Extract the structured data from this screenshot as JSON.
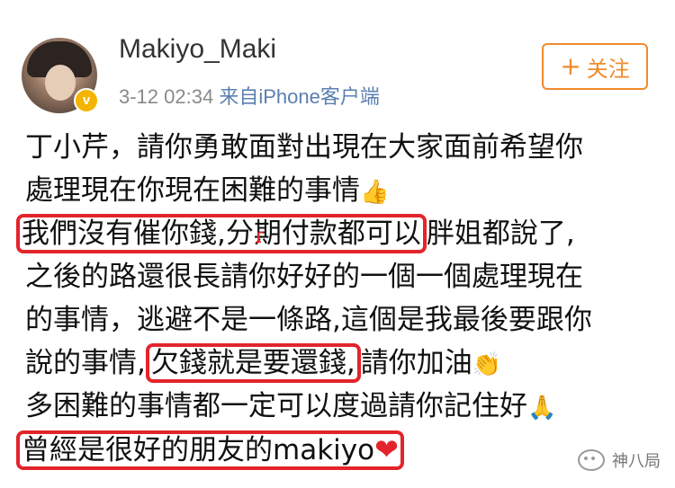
{
  "post": {
    "username": "Makiyo_Maki",
    "timestamp": "3-12 02:34",
    "source": "来自iPhone客户端",
    "follow_label": "关注",
    "verified_mark": "v"
  },
  "content": {
    "line1": "丁小芹，請你勇敢面對出現在大家面前希望你",
    "line2": "處理現在你現在困難的事情",
    "line3_boxed": "我們沒有催你錢,分期付款都可以",
    "line3_rest": "胖姐都說了,",
    "line4": "之後的路還很長請你好好的一個一個處理現在",
    "line5": "的事情，逃避不是一條路,這個是我最後要跟你",
    "line6_pre": "說的事情,",
    "line6_boxed": "欠錢就是要還錢,",
    "line6_post": "請你加油",
    "line7": "多困難的事情都一定可以度過請你記住好",
    "line8_boxed": "曾經是很好的朋友的makiyo"
  },
  "emojis": {
    "thumbs_up": "👍",
    "clap": "👏",
    "pray": "🙏",
    "heart": "❤"
  },
  "watermark": {
    "text": "神八局"
  },
  "colors": {
    "highlight_box": "#e3242b",
    "follow_accent": "#f08a2c",
    "source_link": "#5b7fb0"
  }
}
